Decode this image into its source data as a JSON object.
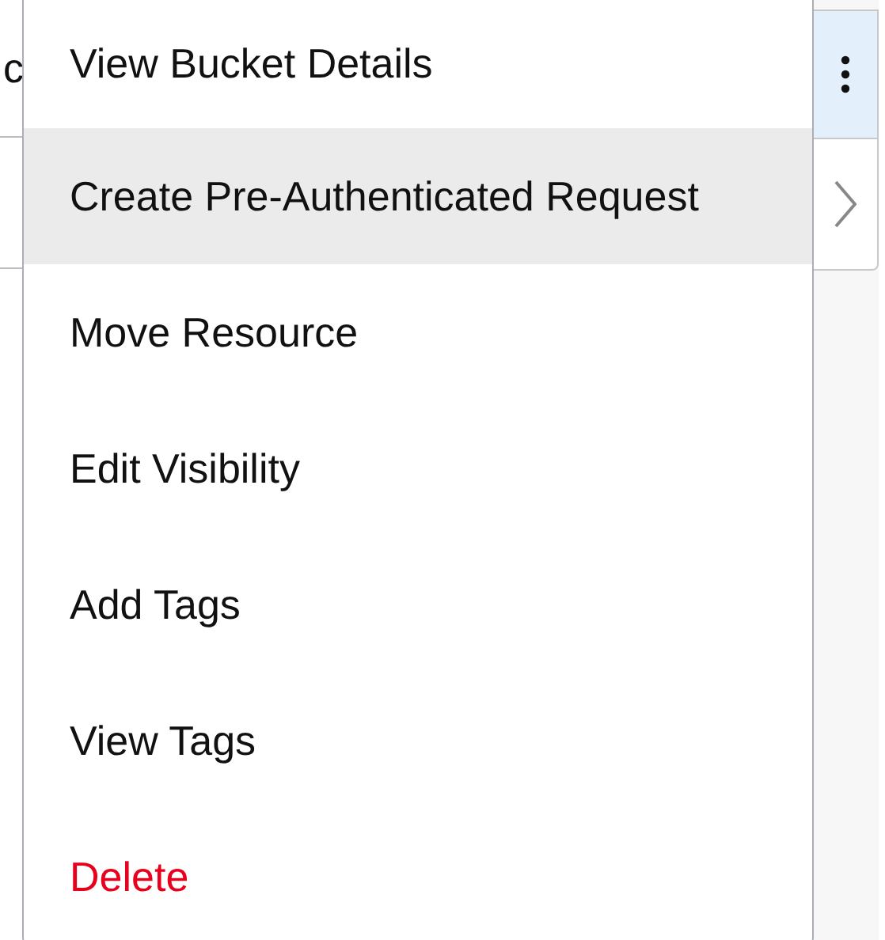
{
  "background": {
    "cut_text": "c"
  },
  "menu": {
    "items": [
      {
        "label": "View Bucket Details",
        "kind": "normal",
        "selected": false
      },
      {
        "label": "Create Pre-Authenticated Request",
        "kind": "normal",
        "selected": true
      },
      {
        "label": "Move Resource",
        "kind": "normal",
        "selected": false
      },
      {
        "label": "Edit Visibility",
        "kind": "normal",
        "selected": false
      },
      {
        "label": "Add Tags",
        "kind": "normal",
        "selected": false
      },
      {
        "label": "View Tags",
        "kind": "normal",
        "selected": false
      },
      {
        "label": "Delete",
        "kind": "danger",
        "selected": false
      }
    ]
  }
}
